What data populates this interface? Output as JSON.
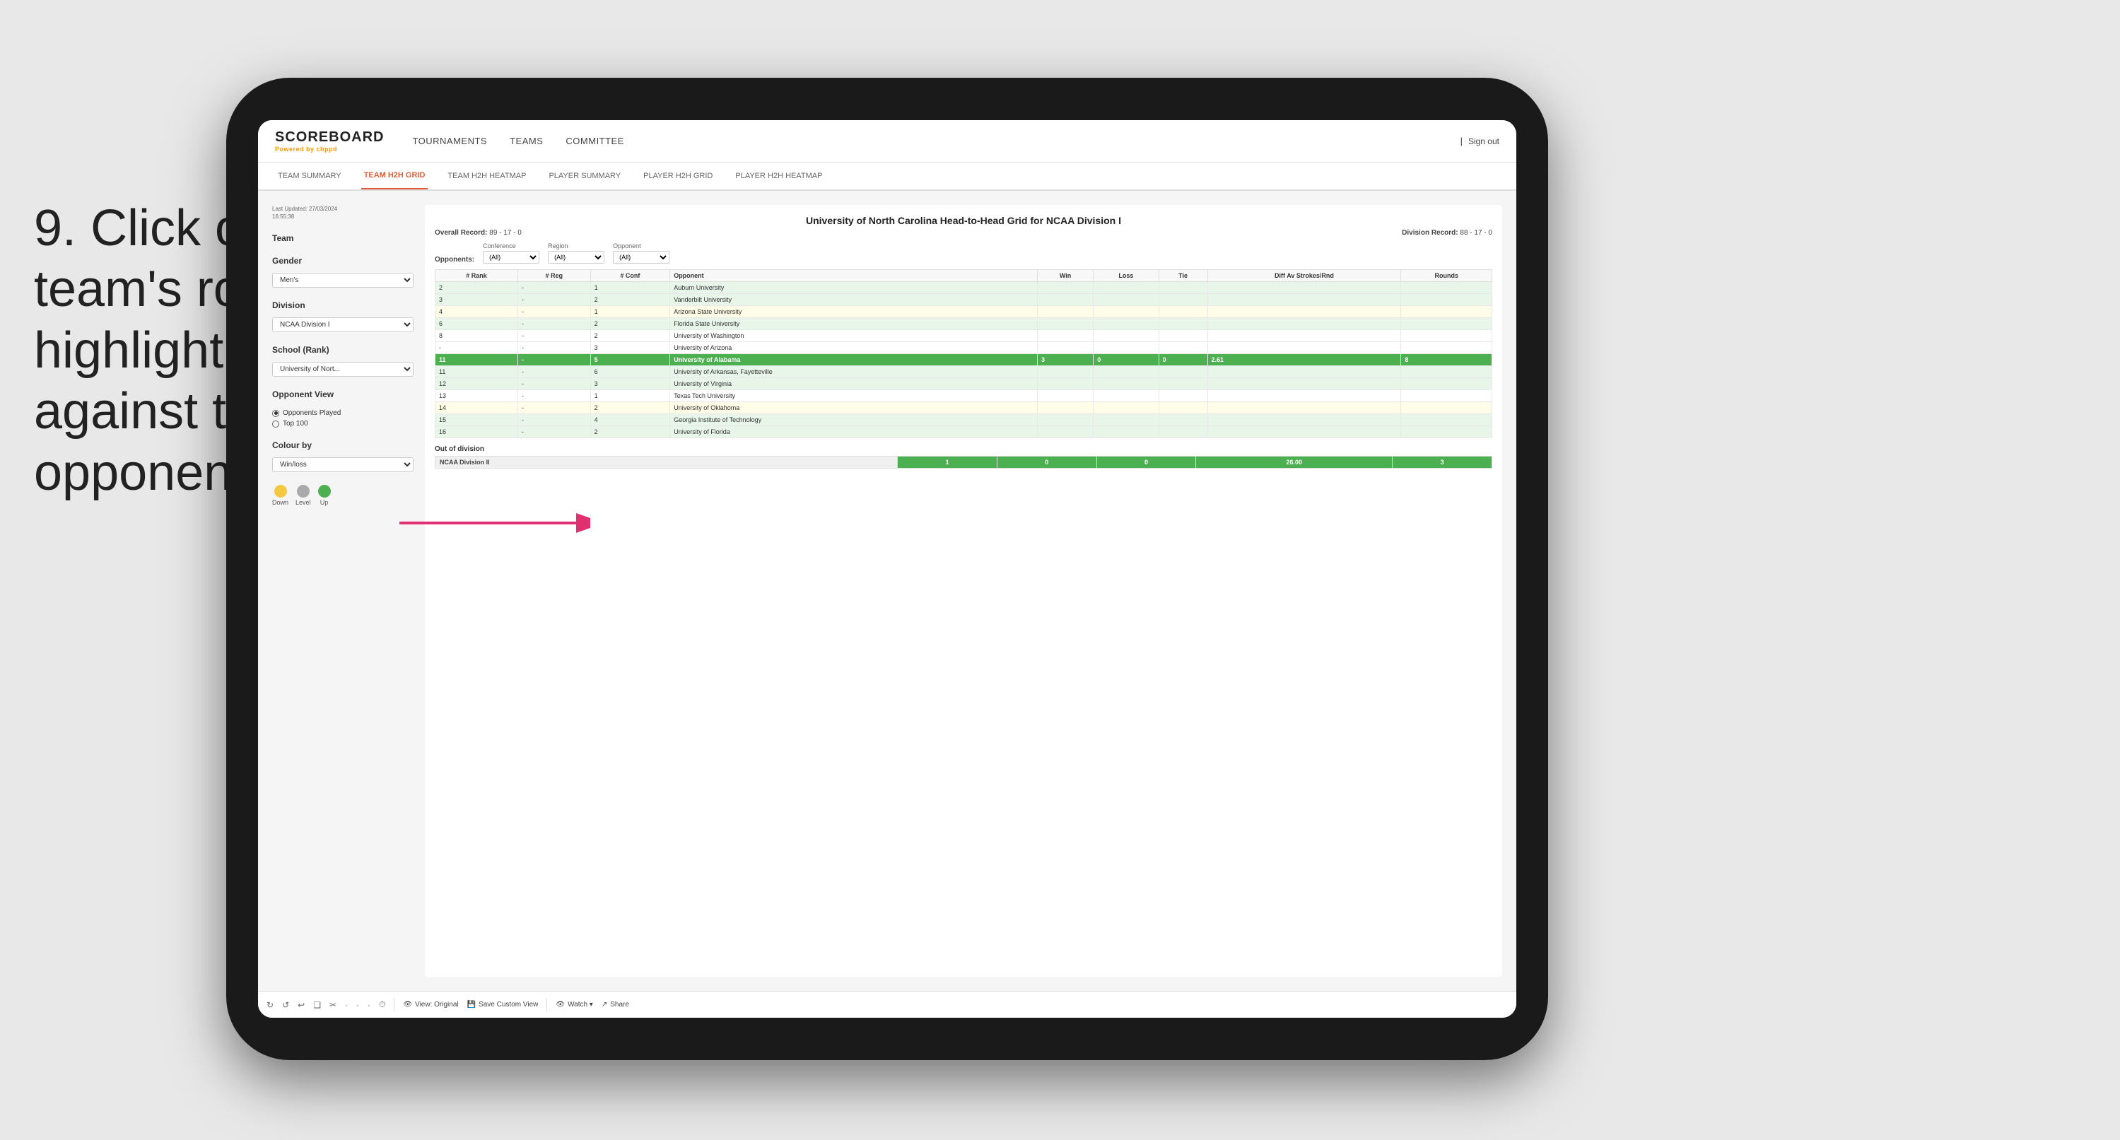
{
  "instruction": {
    "number": "9.",
    "line1": "Click on a",
    "line2": "team's row to",
    "line3": "highlight results",
    "line4": "against that",
    "line5": "opponent"
  },
  "nav": {
    "logo_main": "SCOREBOARD",
    "logo_powered": "Powered by",
    "logo_brand": "clippd",
    "links": [
      "TOURNAMENTS",
      "TEAMS",
      "COMMITTEE"
    ],
    "sign_out_separator": "|",
    "sign_out": "Sign out"
  },
  "sub_nav": {
    "items": [
      {
        "label": "TEAM SUMMARY",
        "active": false
      },
      {
        "label": "TEAM H2H GRID",
        "active": true
      },
      {
        "label": "TEAM H2H HEATMAP",
        "active": false
      },
      {
        "label": "PLAYER SUMMARY",
        "active": false
      },
      {
        "label": "PLAYER H2H GRID",
        "active": false
      },
      {
        "label": "PLAYER H2H HEATMAP",
        "active": false
      }
    ]
  },
  "left_panel": {
    "last_updated_label": "Last Updated: 27/03/2024",
    "last_updated_time": "16:55:38",
    "team_label": "Team",
    "gender_label": "Gender",
    "gender_value": "Men's",
    "division_label": "Division",
    "division_value": "NCAA Division I",
    "school_label": "School (Rank)",
    "school_value": "University of Nort...",
    "opponent_view_label": "Opponent View",
    "radio_opponents": "Opponents Played",
    "radio_top100": "Top 100",
    "colour_by_label": "Colour by",
    "colour_by_value": "Win/loss",
    "legend": [
      {
        "label": "Down",
        "color": "yellow"
      },
      {
        "label": "Level",
        "color": "gray"
      },
      {
        "label": "Up",
        "color": "green"
      }
    ]
  },
  "grid": {
    "title": "University of North Carolina Head-to-Head Grid for NCAA Division I",
    "overall_record_label": "Overall Record:",
    "overall_record": "89 - 17 - 0",
    "division_record_label": "Division Record:",
    "division_record": "88 - 17 - 0",
    "filters": {
      "conference_label": "Conference",
      "conference_value": "(All)",
      "region_label": "Region",
      "region_value": "(All)",
      "opponent_label": "Opponent",
      "opponent_value": "(All)",
      "opponents_label": "Opponents:"
    },
    "table_headers": [
      "# Rank",
      "# Reg",
      "# Conf",
      "Opponent",
      "Win",
      "Loss",
      "Tie",
      "Diff Av Strokes/Rnd",
      "Rounds"
    ],
    "rows": [
      {
        "rank": "2",
        "reg": "-",
        "conf": "1",
        "opponent": "Auburn University",
        "win": "",
        "loss": "",
        "tie": "",
        "diff": "",
        "rounds": "",
        "style": "light-green"
      },
      {
        "rank": "3",
        "reg": "-",
        "conf": "2",
        "opponent": "Vanderbilt University",
        "win": "",
        "loss": "",
        "tie": "",
        "diff": "",
        "rounds": "",
        "style": "light-green"
      },
      {
        "rank": "4",
        "reg": "-",
        "conf": "1",
        "opponent": "Arizona State University",
        "win": "",
        "loss": "",
        "tie": "",
        "diff": "",
        "rounds": "",
        "style": "light-yellow"
      },
      {
        "rank": "6",
        "reg": "-",
        "conf": "2",
        "opponent": "Florida State University",
        "win": "",
        "loss": "",
        "tie": "",
        "diff": "",
        "rounds": "",
        "style": "light-green"
      },
      {
        "rank": "8",
        "reg": "-",
        "conf": "2",
        "opponent": "University of Washington",
        "win": "",
        "loss": "",
        "tie": "",
        "diff": "",
        "rounds": "",
        "style": ""
      },
      {
        "rank": "-",
        "reg": "-",
        "conf": "3",
        "opponent": "University of Arizona",
        "win": "",
        "loss": "",
        "tie": "",
        "diff": "",
        "rounds": "",
        "style": ""
      },
      {
        "rank": "11",
        "reg": "-",
        "conf": "5",
        "opponent": "University of Alabama",
        "win": "3",
        "loss": "0",
        "tie": "0",
        "diff": "2.61",
        "rounds": "8",
        "style": "highlighted"
      },
      {
        "rank": "11",
        "reg": "-",
        "conf": "6",
        "opponent": "University of Arkansas, Fayetteville",
        "win": "",
        "loss": "",
        "tie": "",
        "diff": "",
        "rounds": "",
        "style": "light-green"
      },
      {
        "rank": "12",
        "reg": "-",
        "conf": "3",
        "opponent": "University of Virginia",
        "win": "",
        "loss": "",
        "tie": "",
        "diff": "",
        "rounds": "",
        "style": "light-green"
      },
      {
        "rank": "13",
        "reg": "-",
        "conf": "1",
        "opponent": "Texas Tech University",
        "win": "",
        "loss": "",
        "tie": "",
        "diff": "",
        "rounds": "",
        "style": ""
      },
      {
        "rank": "14",
        "reg": "-",
        "conf": "2",
        "opponent": "University of Oklahoma",
        "win": "",
        "loss": "",
        "tie": "",
        "diff": "",
        "rounds": "",
        "style": "light-yellow"
      },
      {
        "rank": "15",
        "reg": "-",
        "conf": "4",
        "opponent": "Georgia Institute of Technology",
        "win": "",
        "loss": "",
        "tie": "",
        "diff": "",
        "rounds": "",
        "style": "light-green"
      },
      {
        "rank": "16",
        "reg": "-",
        "conf": "2",
        "opponent": "University of Florida",
        "win": "",
        "loss": "",
        "tie": "",
        "diff": "",
        "rounds": "",
        "style": "light-green"
      }
    ],
    "out_of_division_label": "Out of division",
    "out_row": {
      "division": "NCAA Division II",
      "win": "1",
      "loss": "0",
      "tie": "0",
      "diff": "26.00",
      "rounds": "3"
    }
  },
  "toolbar": {
    "buttons": [
      "⟲",
      "⟳",
      "↺",
      "❐",
      "✂",
      "·",
      "·",
      "·",
      "⏱"
    ],
    "view_label": "View: Original",
    "save_label": "Save Custom View",
    "watch_label": "Watch ▾",
    "share_label": "Share"
  }
}
